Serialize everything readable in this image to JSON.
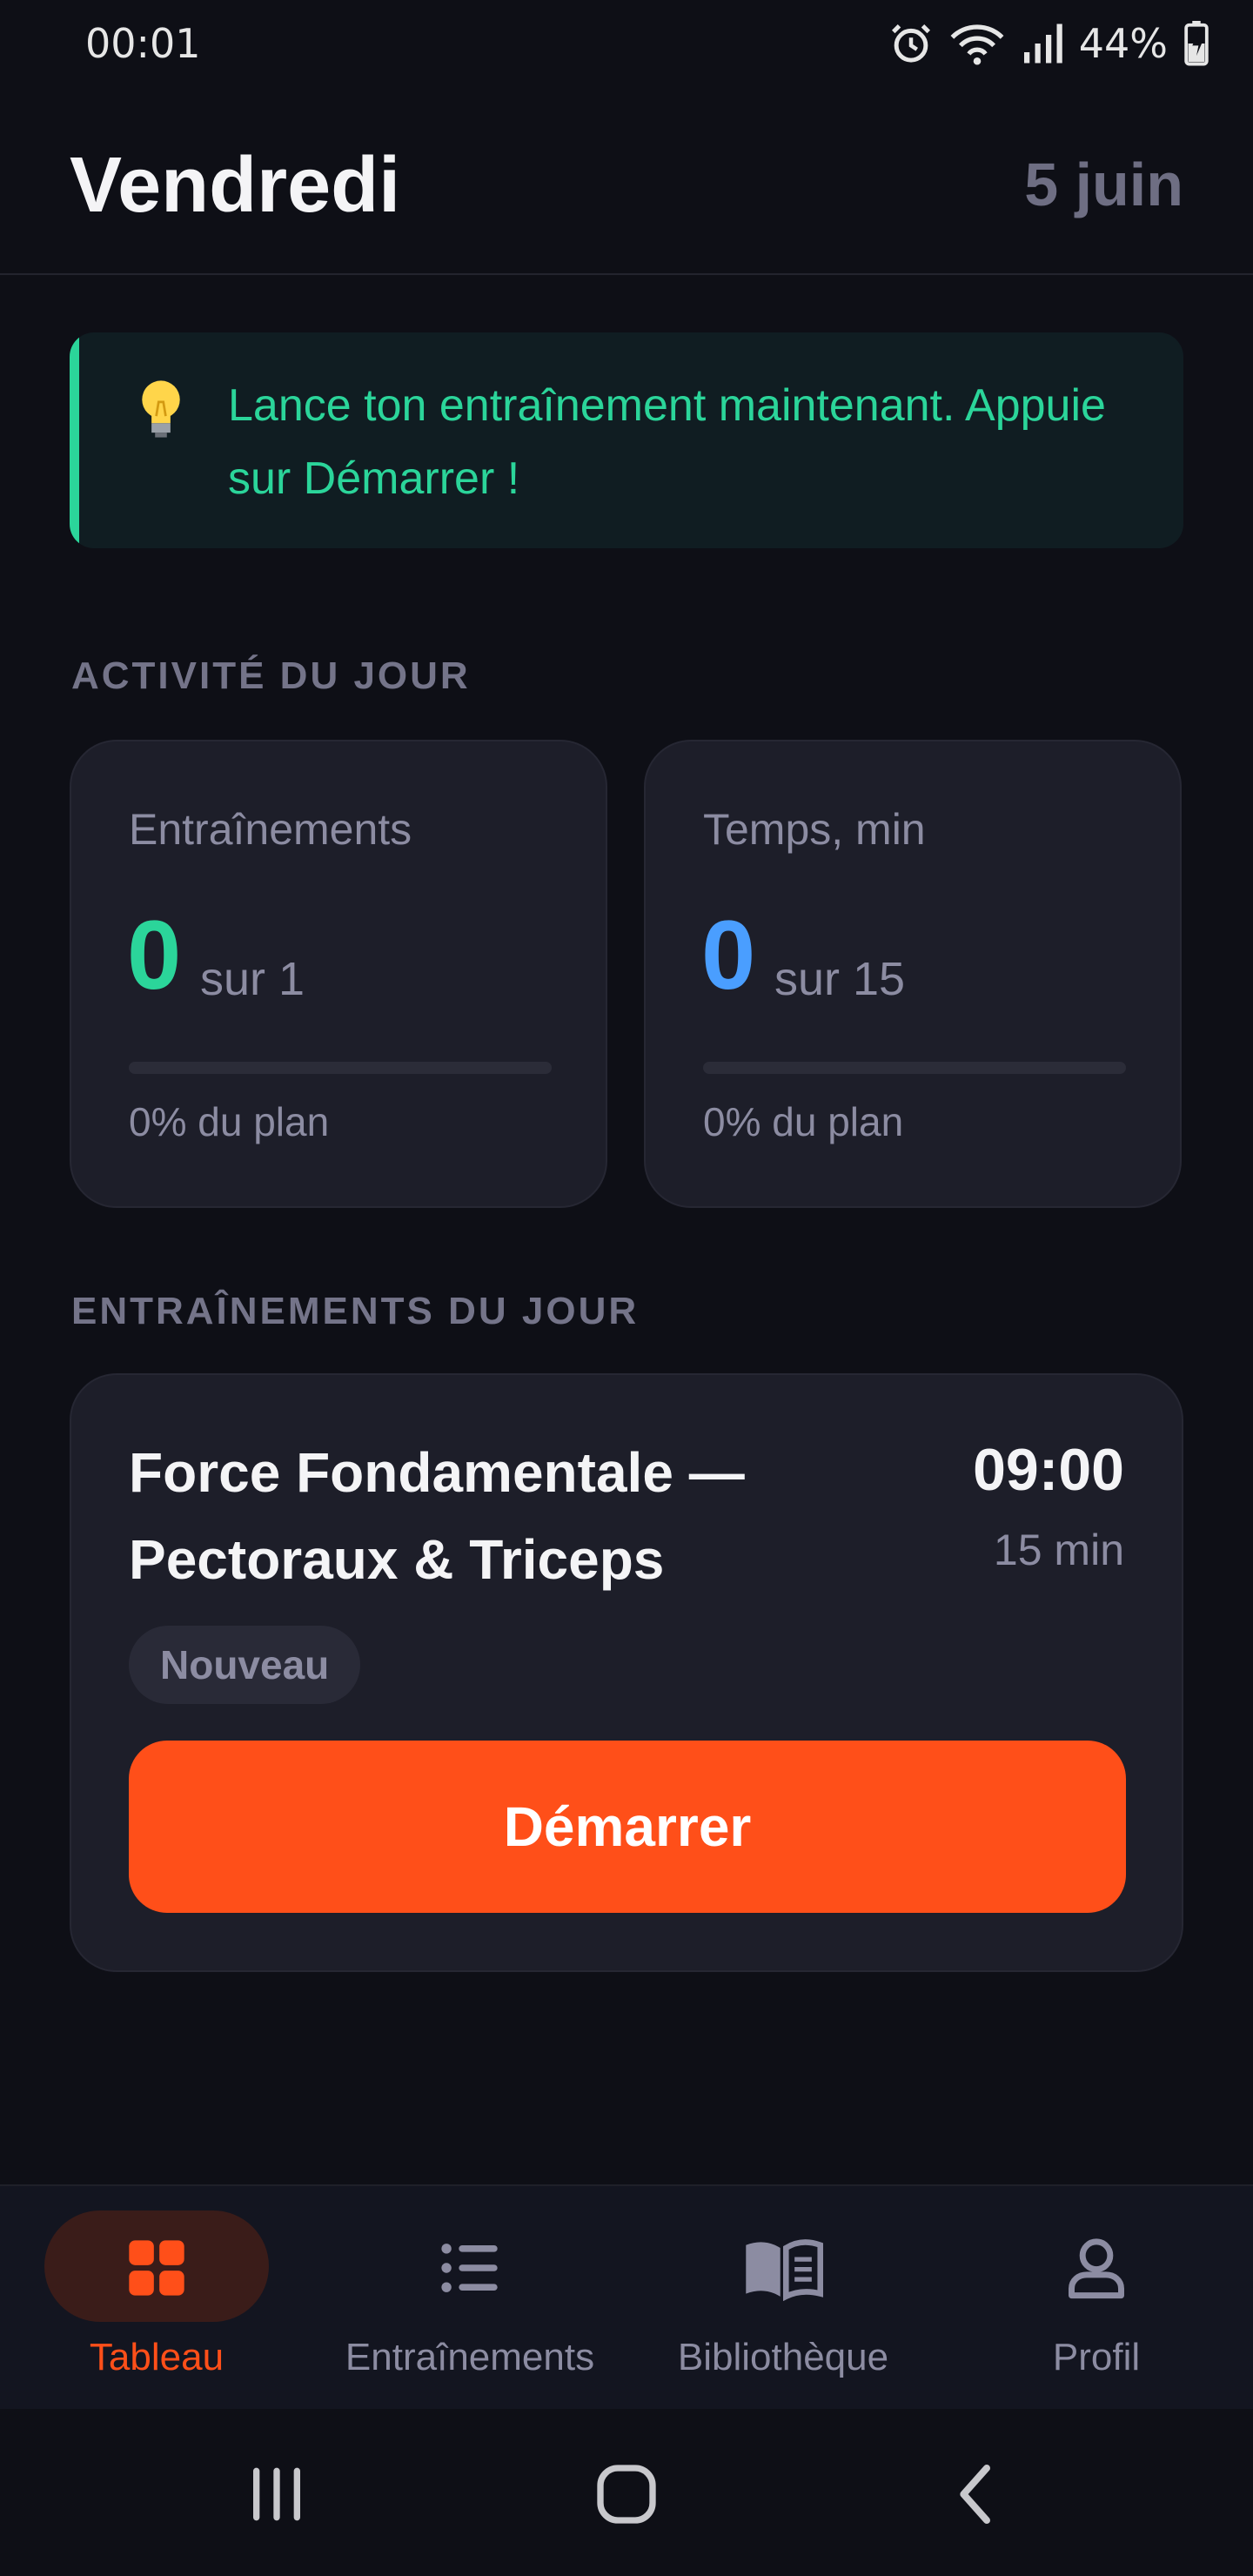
{
  "status": {
    "time": "00:01",
    "battery": "44%"
  },
  "header": {
    "day": "Vendredi",
    "date": "5 juin"
  },
  "tip": {
    "icon": "lightbulb-icon",
    "text": "Lance ton entraînement maintenant. Appuie sur Démarrer !"
  },
  "activity": {
    "title": "ACTIVITÉ DU JOUR",
    "cards": [
      {
        "label": "Entraînements",
        "value": "0",
        "of": "sur 1",
        "foot": "0% du plan",
        "progress": 0,
        "color": "#2bd59a"
      },
      {
        "label": "Temps, min",
        "value": "0",
        "of": "sur 15",
        "foot": "0% du plan",
        "progress": 0,
        "color": "#4a9eff"
      }
    ]
  },
  "workouts": {
    "title": "ENTRAÎNEMENTS DU JOUR",
    "items": [
      {
        "title": "Force Fondamentale — Pectoraux & Triceps",
        "time": "09:00",
        "duration": "15 min",
        "badge": "Nouveau",
        "start_label": "Démarrer"
      }
    ]
  },
  "nav": {
    "items": [
      {
        "label": "Tableau",
        "icon": "dashboard-icon",
        "active": true
      },
      {
        "label": "Entraînements",
        "icon": "list-icon",
        "active": false
      },
      {
        "label": "Bibliothèque",
        "icon": "book-icon",
        "active": false
      },
      {
        "label": "Profil",
        "icon": "profile-icon",
        "active": false
      }
    ]
  },
  "colors": {
    "accent": "#ff4f19",
    "green": "#2bd59a",
    "blue": "#4a9eff",
    "background": "#0e0f16",
    "card": "#1d1e29"
  }
}
